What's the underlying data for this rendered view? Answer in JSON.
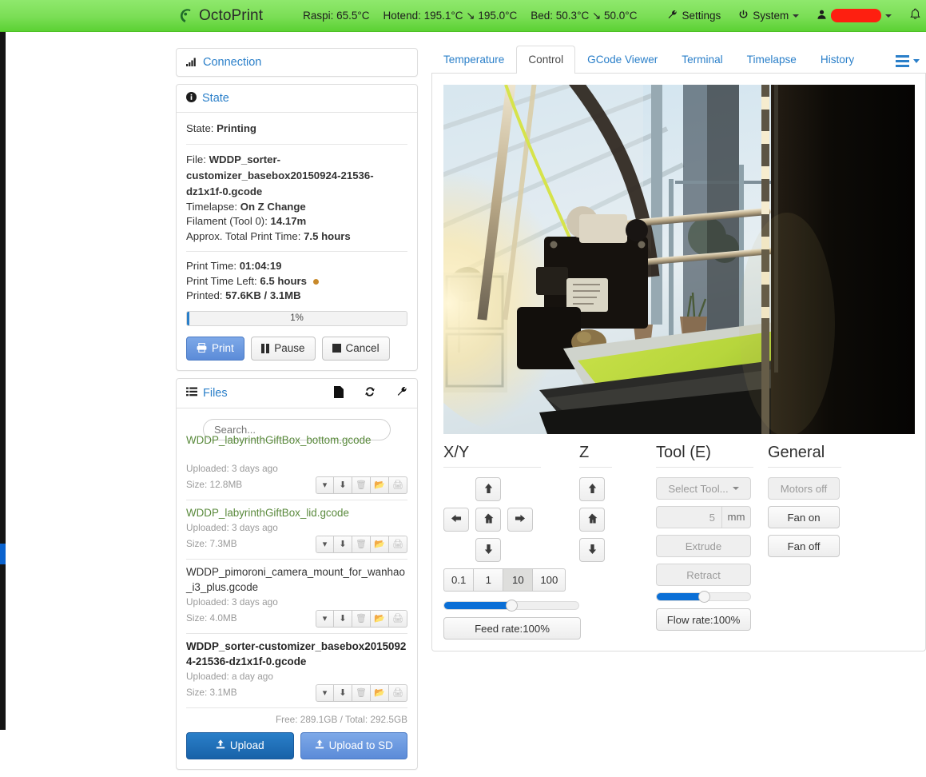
{
  "navbar": {
    "brand": "OctoPrint",
    "temps": [
      "Raspi: 65.5°C",
      "Hotend: 195.1°C ↘ 195.0°C",
      "Bed: 50.3°C ↘ 50.0°C"
    ],
    "settings_label": "Settings",
    "system_label": "System",
    "settings_icon": "wrench-icon",
    "system_icon": "power-icon",
    "user_icon": "user-icon",
    "user_name_redacted": "",
    "bell_icon": "bell-icon",
    "accent_green": "#7ade55"
  },
  "sidebar": {
    "connection": {
      "title": "Connection",
      "icon": "signal-bars-icon"
    },
    "state": {
      "title": "State",
      "icon": "info-circle-icon",
      "state_label": "State:",
      "state_value": "Printing",
      "file_label": "File:",
      "file_value": "WDDP_sorter-customizer_basebox20150924-21536-dz1x1f-0.gcode",
      "timelapse_label": "Timelapse:",
      "timelapse_value": "On Z Change",
      "filament_label": "Filament (Tool 0):",
      "filament_value": "14.17m",
      "total_time_label": "Approx. Total Print Time:",
      "total_time_value": "7.5 hours",
      "print_time_label": "Print Time:",
      "print_time_value": "01:04:19",
      "time_left_label": "Print Time Left:",
      "time_left_value": "6.5 hours",
      "printed_label": "Printed:",
      "printed_value": "57.6KB / 3.1MB",
      "progress_text": "1%",
      "progress_percent": 1,
      "buttons": {
        "print": "Print",
        "pause": "Pause",
        "cancel": "Cancel"
      }
    },
    "files": {
      "title": "Files",
      "icon": "list-icon",
      "header_icons": [
        "file-icon",
        "refresh-icon",
        "wrench-icon"
      ],
      "search_placeholder": "Search...",
      "items": [
        {
          "name": "WDDP_labyrinthGiftBox_bottom.gcode",
          "uploaded": "Uploaded: 3 days ago",
          "size": "Size: 12.8MB",
          "style": "green",
          "clipped": true
        },
        {
          "name": "WDDP_labyrinthGiftBox_lid.gcode",
          "uploaded": "Uploaded: 3 days ago",
          "size": "Size: 7.3MB",
          "style": "green",
          "clipped": false
        },
        {
          "name": "WDDP_pimoroni_camera_mount_for_wanhao_i3_plus.gcode",
          "uploaded": "Uploaded: 3 days ago",
          "size": "Size: 4.0MB",
          "style": "plain",
          "clipped": false
        },
        {
          "name": "WDDP_sorter-customizer_basebox20150924-21536-dz1x1f-0.gcode",
          "uploaded": "Uploaded: a day ago",
          "size": "Size: 3.1MB",
          "style": "bold",
          "clipped": false
        }
      ],
      "row_action_icons": [
        "chevron-down-icon",
        "download-icon",
        "trash-icon",
        "folder-open-icon",
        "print-icon"
      ],
      "storage": "Free: 289.1GB / Total: 292.5GB",
      "upload_label": "Upload",
      "upload_sd_label": "Upload to SD"
    }
  },
  "main": {
    "tabs": [
      {
        "label": "Temperature",
        "active": false
      },
      {
        "label": "Control",
        "active": true
      },
      {
        "label": "GCode Viewer",
        "active": false
      },
      {
        "label": "Terminal",
        "active": false
      },
      {
        "label": "Timelapse",
        "active": false
      },
      {
        "label": "History",
        "active": false
      }
    ],
    "tabs_menu_icon": "hamburger-menu-icon",
    "webcam": {
      "alt": "3d-printer-webcam-stream"
    },
    "control": {
      "xy": {
        "heading": "X/Y",
        "up_icon": "arrow-up-icon",
        "left_icon": "arrow-left-icon",
        "home_icon": "home-icon",
        "right_icon": "arrow-right-icon",
        "down_icon": "arrow-down-icon",
        "steps": [
          "0.1",
          "1",
          "10",
          "100"
        ],
        "selected_step": "10",
        "slider_percent": 50,
        "feed_rate_label": "Feed rate:100%"
      },
      "z": {
        "heading": "Z",
        "up_icon": "arrow-up-icon",
        "home_icon": "home-icon",
        "down_icon": "arrow-down-icon"
      },
      "tool": {
        "heading": "Tool (E)",
        "select_tool_label": "Select Tool...",
        "amount_value": "5",
        "amount_unit": "mm",
        "extrude_label": "Extrude",
        "retract_label": "Retract",
        "slider_percent": 50,
        "flow_rate_label": "Flow rate:100%"
      },
      "general": {
        "heading": "General",
        "motors_off_label": "Motors off",
        "fan_on_label": "Fan on",
        "fan_off_label": "Fan off"
      }
    }
  }
}
